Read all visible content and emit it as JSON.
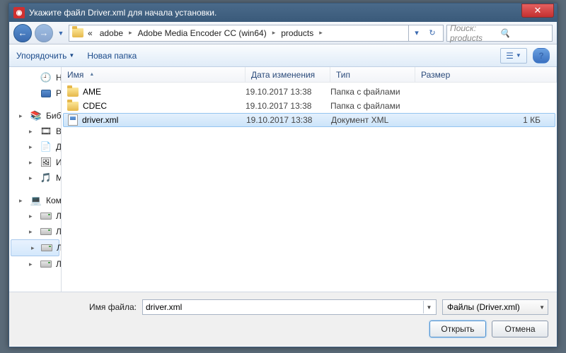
{
  "title": "Укажите файл Driver.xml для начала установки.",
  "breadcrumb": {
    "prefix": "«",
    "segments": [
      "adobe",
      "Adobe Media Encoder CC (win64)",
      "products"
    ]
  },
  "search": {
    "placeholder": "Поиск: products"
  },
  "toolbar": {
    "organize": "Упорядочить",
    "newfolder": "Новая папка"
  },
  "sidebar": {
    "recent": "Недавние места",
    "desktop": "Рабочий стол",
    "libraries": "Библиотеки",
    "video": "Видео",
    "documents": "Документы",
    "images": "Изображения",
    "music": "Музыка",
    "computer": "Компьютер",
    "drive": "Локальный диск"
  },
  "columns": {
    "name": "Имя",
    "date": "Дата изменения",
    "type": "Тип",
    "size": "Размер"
  },
  "files": [
    {
      "name": "AME",
      "date": "19.10.2017 13:38",
      "type": "Папка с файлами",
      "size": "",
      "kind": "folder"
    },
    {
      "name": "CDEC",
      "date": "19.10.2017 13:38",
      "type": "Папка с файлами",
      "size": "",
      "kind": "folder"
    },
    {
      "name": "driver.xml",
      "date": "19.10.2017 13:38",
      "type": "Документ XML",
      "size": "1 КБ",
      "kind": "xml",
      "selected": true
    }
  ],
  "footer": {
    "filename_label": "Имя файла:",
    "filename_value": "driver.xml",
    "filter": "Файлы (Driver.xml)",
    "open": "Открыть",
    "cancel": "Отмена"
  }
}
